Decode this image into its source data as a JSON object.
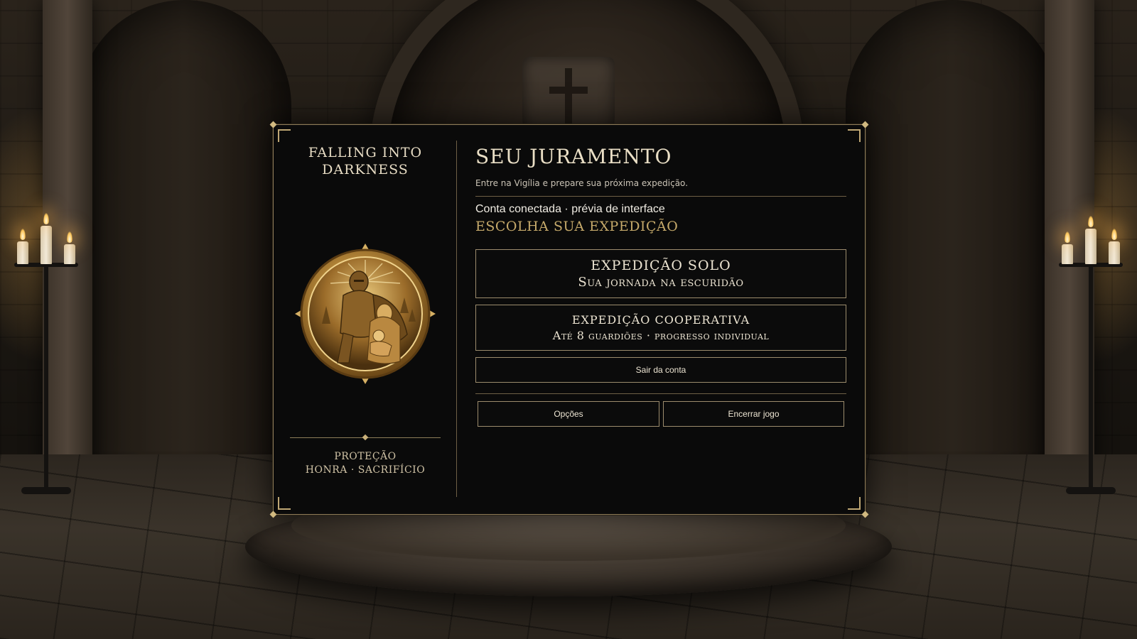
{
  "game": {
    "title": "FALLING INTO DARKNESS",
    "motto_line1": "PROTEÇÃO",
    "motto_line2": "HONRA · SACRIFÍCIO",
    "emblem_icon": "knight-madonna-medallion-icon"
  },
  "main": {
    "title": "SEU JURAMENTO",
    "subtitle": "Entre na Vigília e prepare sua próxima expedição.",
    "account_status": "Conta conectada · prévia de interface",
    "section_label": "ESCOLHA SUA EXPEDIÇÃO",
    "solo": {
      "title": "EXPEDIÇÃO SOLO",
      "subtitle": "Sua jornada na escuridão"
    },
    "coop": {
      "title": "EXPEDIÇÃO COOPERATIVA",
      "subtitle": "Até 8 guardiões · progresso individual"
    },
    "logout_label": "Sair da conta",
    "options_label": "Opções",
    "quit_label": "Encerrar jogo"
  },
  "colors": {
    "panel_bg": "#0a0a0a",
    "gold_accent": "#c5a96a",
    "border": "#9c8c6d"
  }
}
